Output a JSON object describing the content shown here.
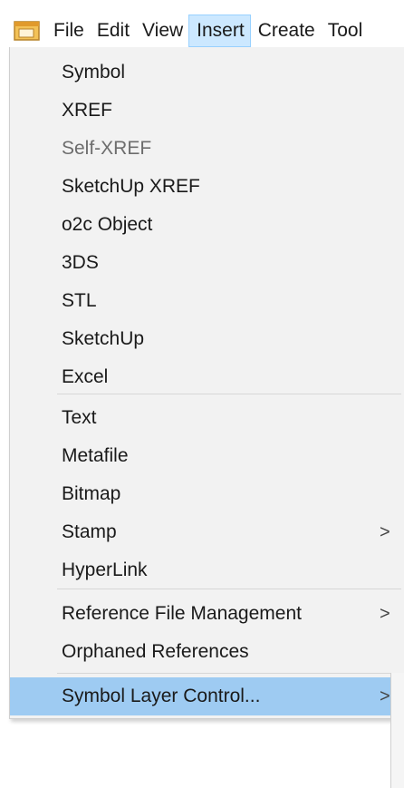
{
  "menubar": {
    "icon": "app-window-icon",
    "items": [
      {
        "label": "File"
      },
      {
        "label": "Edit"
      },
      {
        "label": "View"
      },
      {
        "label": "Insert",
        "active": true
      },
      {
        "label": "Create"
      },
      {
        "label": "Tool"
      }
    ]
  },
  "insert_menu": {
    "items": [
      {
        "label": "Symbol"
      },
      {
        "label": "XREF"
      },
      {
        "label": "Self-XREF",
        "disabled": true
      },
      {
        "label": "SketchUp XREF"
      },
      {
        "label": "o2c Object"
      },
      {
        "label": "3DS"
      },
      {
        "label": "STL"
      },
      {
        "label": "SketchUp"
      },
      {
        "label": "Excel"
      },
      {
        "label": "Text"
      },
      {
        "label": "Metafile"
      },
      {
        "label": "Bitmap"
      },
      {
        "label": "Stamp",
        "submenu": ">"
      },
      {
        "label": "HyperLink"
      },
      {
        "label": "Reference File Management",
        "submenu": ">"
      },
      {
        "label": "Orphaned References"
      },
      {
        "label": "Symbol Layer Control...",
        "submenu": ">",
        "highlighted": true
      }
    ]
  },
  "colors": {
    "menu_background": "#f2f2f2",
    "active_menubar_item": "#cce8ff",
    "highlight": "#9ecbf2",
    "disabled_text": "#6d6d6d"
  }
}
